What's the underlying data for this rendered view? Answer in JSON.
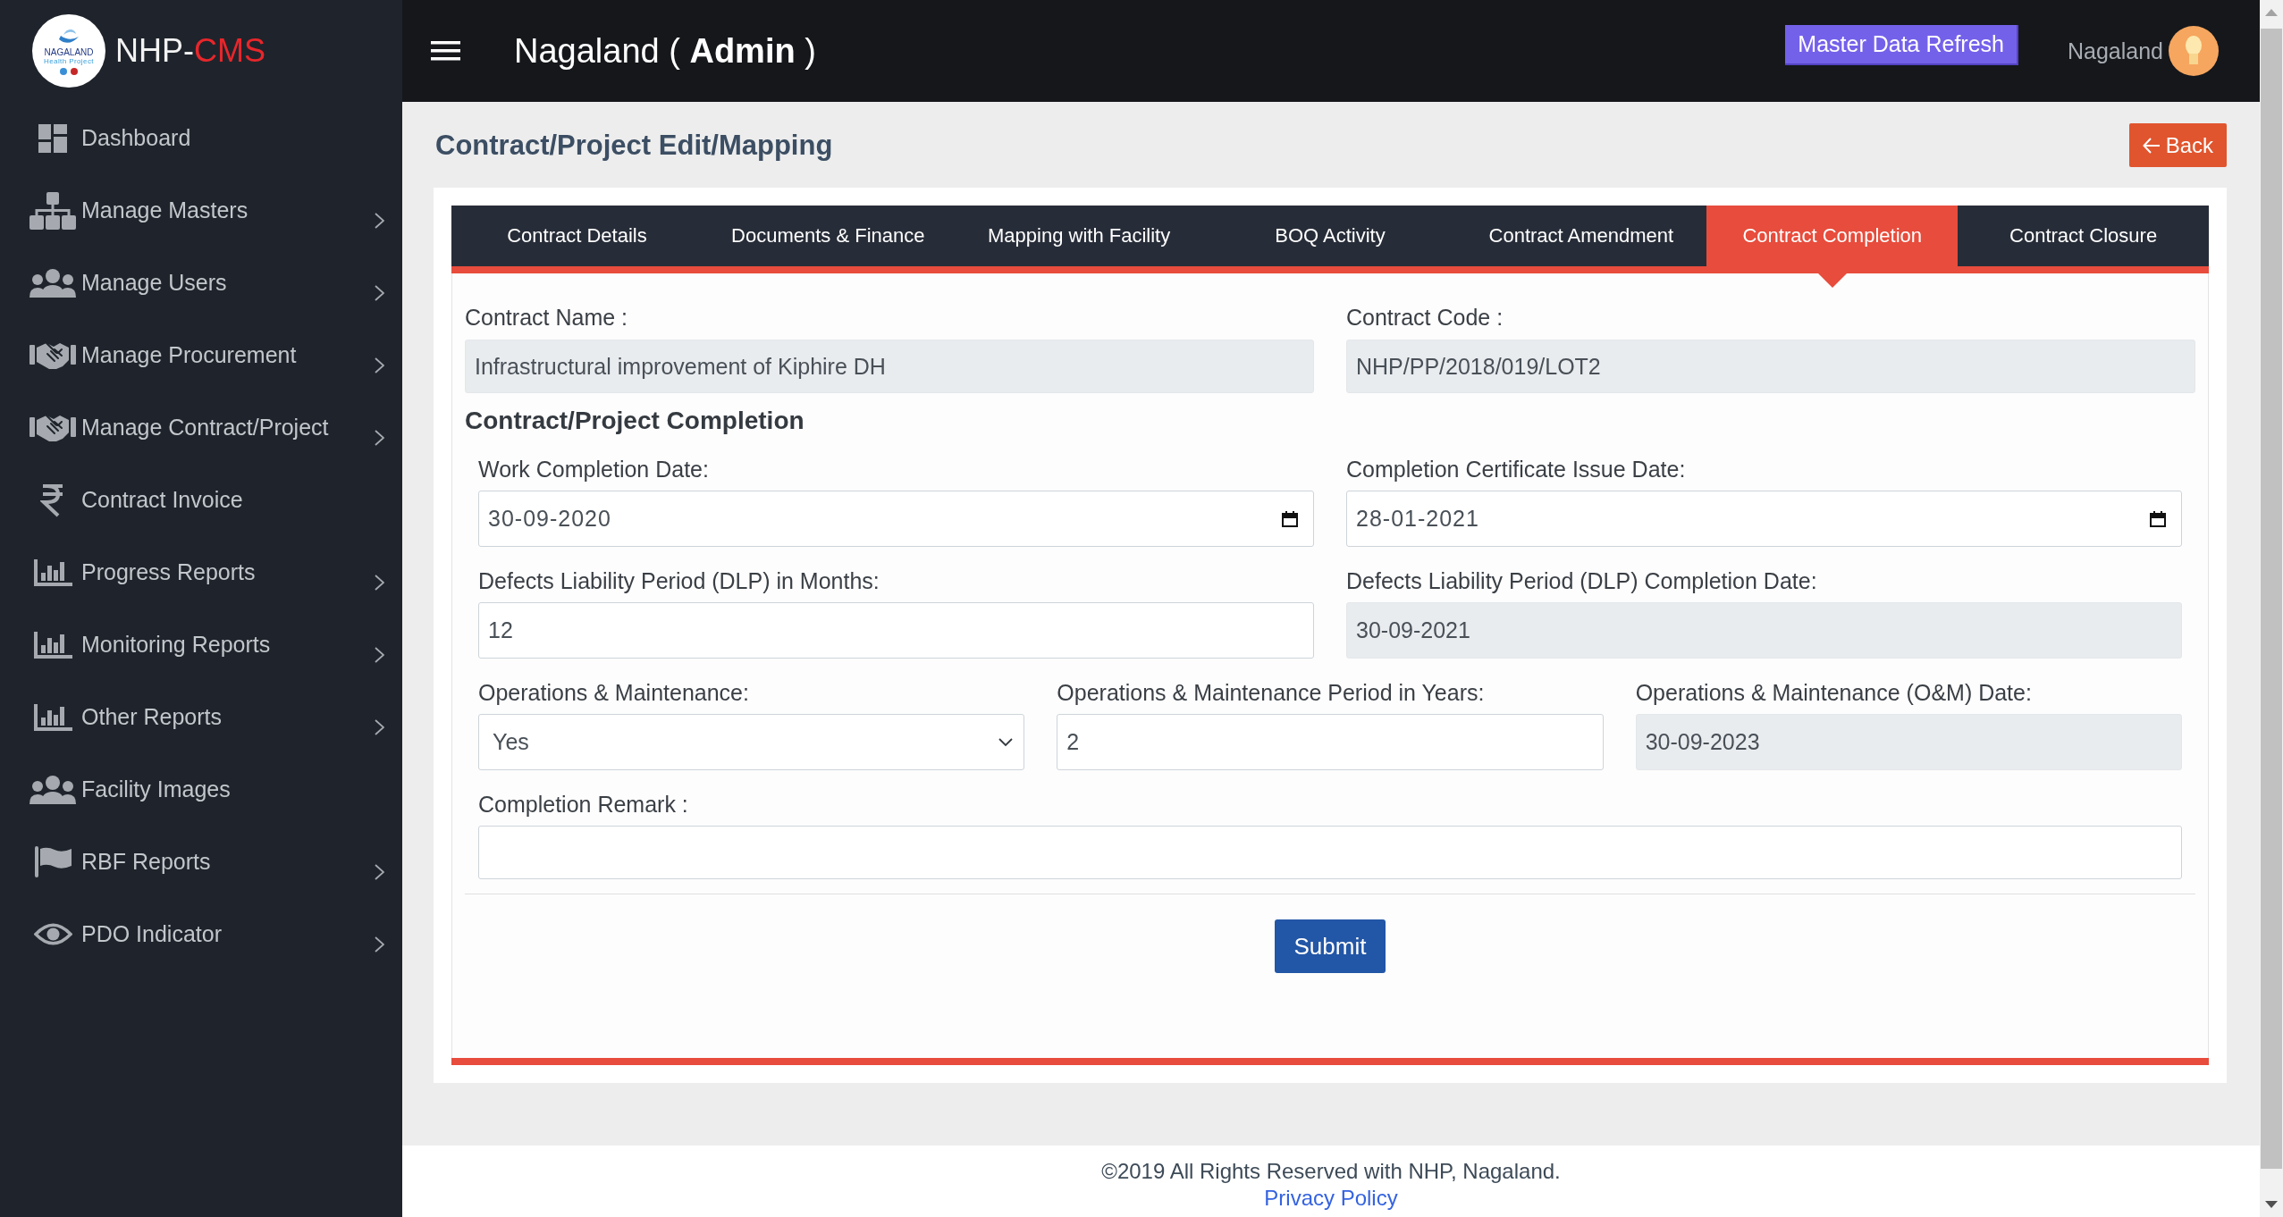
{
  "sidebar": {
    "logo": {
      "title": "NAGALAND",
      "subtitle": "Health Project"
    },
    "brand": {
      "prefix": "NHP-",
      "accent": "CMS"
    },
    "items": [
      {
        "label": "Dashboard",
        "has_submenu": false,
        "selected": false
      },
      {
        "label": "Manage Masters",
        "has_submenu": true,
        "selected": false
      },
      {
        "label": "Manage Users",
        "has_submenu": true,
        "selected": false
      },
      {
        "label": "Manage Procurement",
        "has_submenu": true,
        "selected": false
      },
      {
        "label": "Manage Contract/Project",
        "has_submenu": true,
        "selected": false
      },
      {
        "label": "Contract Invoice",
        "has_submenu": false,
        "selected": false
      },
      {
        "label": "Progress Reports",
        "has_submenu": true,
        "selected": false
      },
      {
        "label": "Monitoring Reports",
        "has_submenu": true,
        "selected": false
      },
      {
        "label": "Other Reports",
        "has_submenu": true,
        "selected": false
      },
      {
        "label": "Facility Images",
        "has_submenu": false,
        "selected": false
      },
      {
        "label": "RBF Reports",
        "has_submenu": true,
        "selected": false
      },
      {
        "label": "PDO Indicator",
        "has_submenu": true,
        "selected": false
      }
    ]
  },
  "header": {
    "title": "Nagaland ( **Admin** )",
    "refresh_button": "Master Data Refresh",
    "user": {
      "name": "Nagaland"
    }
  },
  "page": {
    "title": "Contract/Project Edit/Mapping",
    "back_button": "Back"
  },
  "tabs": [
    {
      "label": "Contract Details",
      "selected": false
    },
    {
      "label": "Documents & Finance",
      "selected": false
    },
    {
      "label": "Mapping with Facility",
      "selected": false
    },
    {
      "label": "BOQ Activity",
      "selected": false
    },
    {
      "label": "Contract Amendment",
      "selected": false
    },
    {
      "label": "Contract Completion",
      "selected": true
    },
    {
      "label": "Contract Closure",
      "selected": false
    }
  ],
  "contract": {
    "fields": [
      {
        "label": "Contract Name :",
        "value": "Infrastructural improvement of Kiphire DH",
        "kind": "text",
        "readonly": true
      },
      {
        "label": "Contract Code :",
        "value": "NHP/PP/2018/019/LOT2",
        "kind": "text",
        "readonly": true
      }
    ]
  },
  "completion": {
    "heading": "Contract/Project Completion",
    "rows": [
      {
        "fields": [
          {
            "label": "Work Completion Date:",
            "value": "30-09-2020",
            "kind": "date",
            "readonly": false
          },
          {
            "label": "Completion Certificate Issue Date:",
            "value": "28-01-2021",
            "kind": "date",
            "readonly": false
          }
        ]
      },
      {
        "fields": [
          {
            "label": "Defects Liability Period (DLP) in Months:",
            "value": "12",
            "kind": "text",
            "readonly": false
          },
          {
            "label": "Defects Liability Period (DLP) Completion Date:",
            "value": "30-09-2021",
            "kind": "text",
            "readonly": true
          }
        ]
      },
      {
        "fields": [
          {
            "label": "Operations & Maintenance:",
            "value": "Yes",
            "kind": "select",
            "readonly": false
          },
          {
            "label": "Operations & Maintenance Period in Years:",
            "value": "2",
            "kind": "text",
            "readonly": false
          },
          {
            "label": "Operations & Maintenance (O&M) Date:",
            "value": "30-09-2023",
            "kind": "text",
            "readonly": true
          }
        ]
      },
      {
        "fields": [
          {
            "label": "Completion Remark :",
            "kind": "textarea",
            "readonly": false
          }
        ]
      }
    ],
    "submit_button": "Submit"
  },
  "footer": {
    "copyright": "©2019 All Rights Reserved with NHP, Nagaland.",
    "privacy_link": "Privacy Policy"
  }
}
